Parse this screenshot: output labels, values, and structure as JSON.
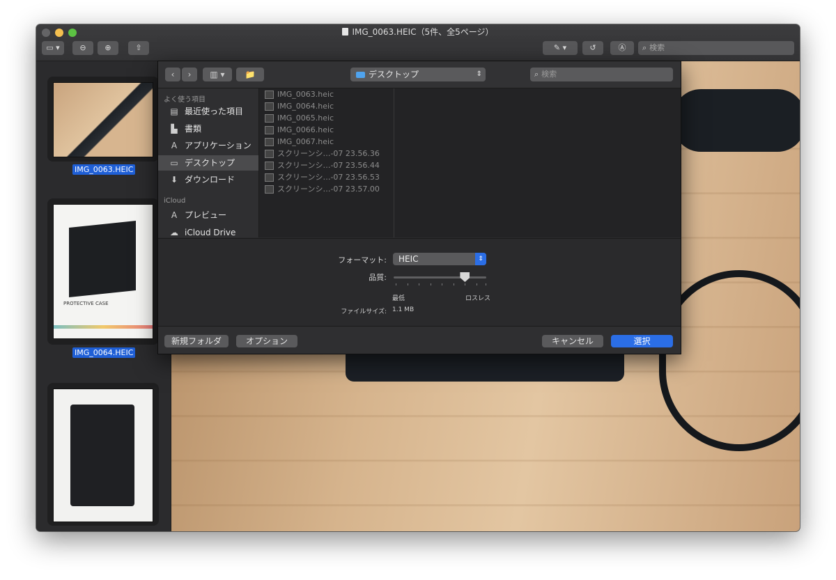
{
  "window": {
    "title": "IMG_0063.HEIC（5件、全5ページ）",
    "search_placeholder": "検索"
  },
  "sidebar": {
    "thumbnails": [
      {
        "label": "IMG_0063.HEIC",
        "selected": true
      },
      {
        "label": "IMG_0064.HEIC",
        "selected": true
      },
      {
        "label": "",
        "selected": false
      }
    ],
    "thumb2_text": "PROTECTIVE CASE"
  },
  "dialog": {
    "location": "デスクトップ",
    "search_placeholder": "検索",
    "sections": [
      {
        "header": "よく使う項目",
        "items": [
          {
            "label": "最近使った項目",
            "icon": "recents-icon"
          },
          {
            "label": "書類",
            "icon": "documents-icon"
          },
          {
            "label": "アプリケーション",
            "icon": "applications-icon"
          },
          {
            "label": "デスクトップ",
            "icon": "desktop-icon",
            "selected": true
          },
          {
            "label": "ダウンロード",
            "icon": "downloads-icon"
          }
        ]
      },
      {
        "header": "iCloud",
        "items": [
          {
            "label": "プレビュー",
            "icon": "preview-icon"
          },
          {
            "label": "iCloud Drive",
            "icon": "cloud-icon"
          }
        ]
      }
    ],
    "files": [
      "IMG_0063.heic",
      "IMG_0064.heic",
      "IMG_0065.heic",
      "IMG_0066.heic",
      "IMG_0067.heic",
      "スクリーンシ…-07 23.56.36",
      "スクリーンシ…-07 23.56.44",
      "スクリーンシ…-07 23.56.53",
      "スクリーンシ…-07 23.57.00"
    ],
    "format_label": "フォーマット:",
    "format_value": "HEIC",
    "quality_label": "品質:",
    "quality_level": 0.77,
    "quality_min": "最低",
    "quality_max": "ロスレス",
    "filesize_label": "ファイルサイズ:",
    "filesize_value": "1.1 MB",
    "buttons": {
      "new_folder": "新規フォルダ",
      "options": "オプション",
      "cancel": "キャンセル",
      "choose": "選択"
    }
  }
}
